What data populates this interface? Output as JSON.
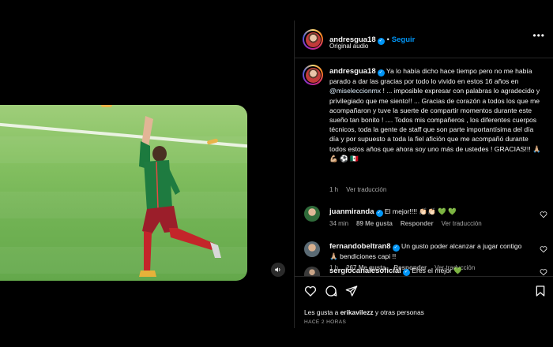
{
  "post": {
    "username": "andresgua18",
    "follow_label": "Seguir",
    "audio": "Original audio",
    "more": "•••"
  },
  "caption": {
    "username": "andresgua18",
    "text_before_mention": " Ya lo había dicho hace tiempo pero no me había parado a dar las gracias por todo lo vivido en estos 16 años en ",
    "mention": "@miseleccionmx",
    "text_after_mention": " ! ... imposible expresar con palabras lo agradecido y privilegiado que me siento!! ... Gracias de corazón a todos los que me acompañaron y tuve la suerte de compartir momentos durante este sueño tan bonito ! .... Todos mis compañeros , los diferentes cuerpos técnicos, toda la gente de staff que son parte importantísima del día día y por supuesto a toda la fiel afición que me acompañó durante todos estos años que ahora soy uno más de ustedes ! GRACIAS!!! 🙏🏼 💪🏼 ⚽ 🇲🇽",
    "time": "1 h",
    "translate": "Ver traducción"
  },
  "comments": [
    {
      "username": "juanmiranda",
      "text": "El mejor!!!! 👏🏻👏🏻 💚 💚",
      "time": "34 min",
      "likes": "89 Me gusta",
      "reply": "Responder",
      "translate": "Ver traducción"
    },
    {
      "username": "fernandobeltran8",
      "text": "Un gusto poder alcanzar a jugar contigo 🙏🏼 bendiciones capi !!",
      "time": "1 h",
      "likes": "267 Me gusta",
      "reply": "Responder",
      "translate": "Ver traducción"
    },
    {
      "username": "sergiocanalesoficial",
      "text": "Eres el mejor 💚"
    }
  ],
  "footer": {
    "likes_prefix": "Les gusta a ",
    "likes_user": "erikavilezz",
    "likes_suffix": " y otras personas",
    "time_ago": "HACE 2 HORAS"
  },
  "colors": {
    "accent": "#0095f6",
    "background": "#000000",
    "muted_text": "#a8a8a8",
    "divider": "#262626"
  },
  "icons": [
    "heart-icon",
    "comment-icon",
    "share-icon",
    "bookmark-icon",
    "speaker-icon",
    "verified-badge-icon",
    "more-icon"
  ]
}
